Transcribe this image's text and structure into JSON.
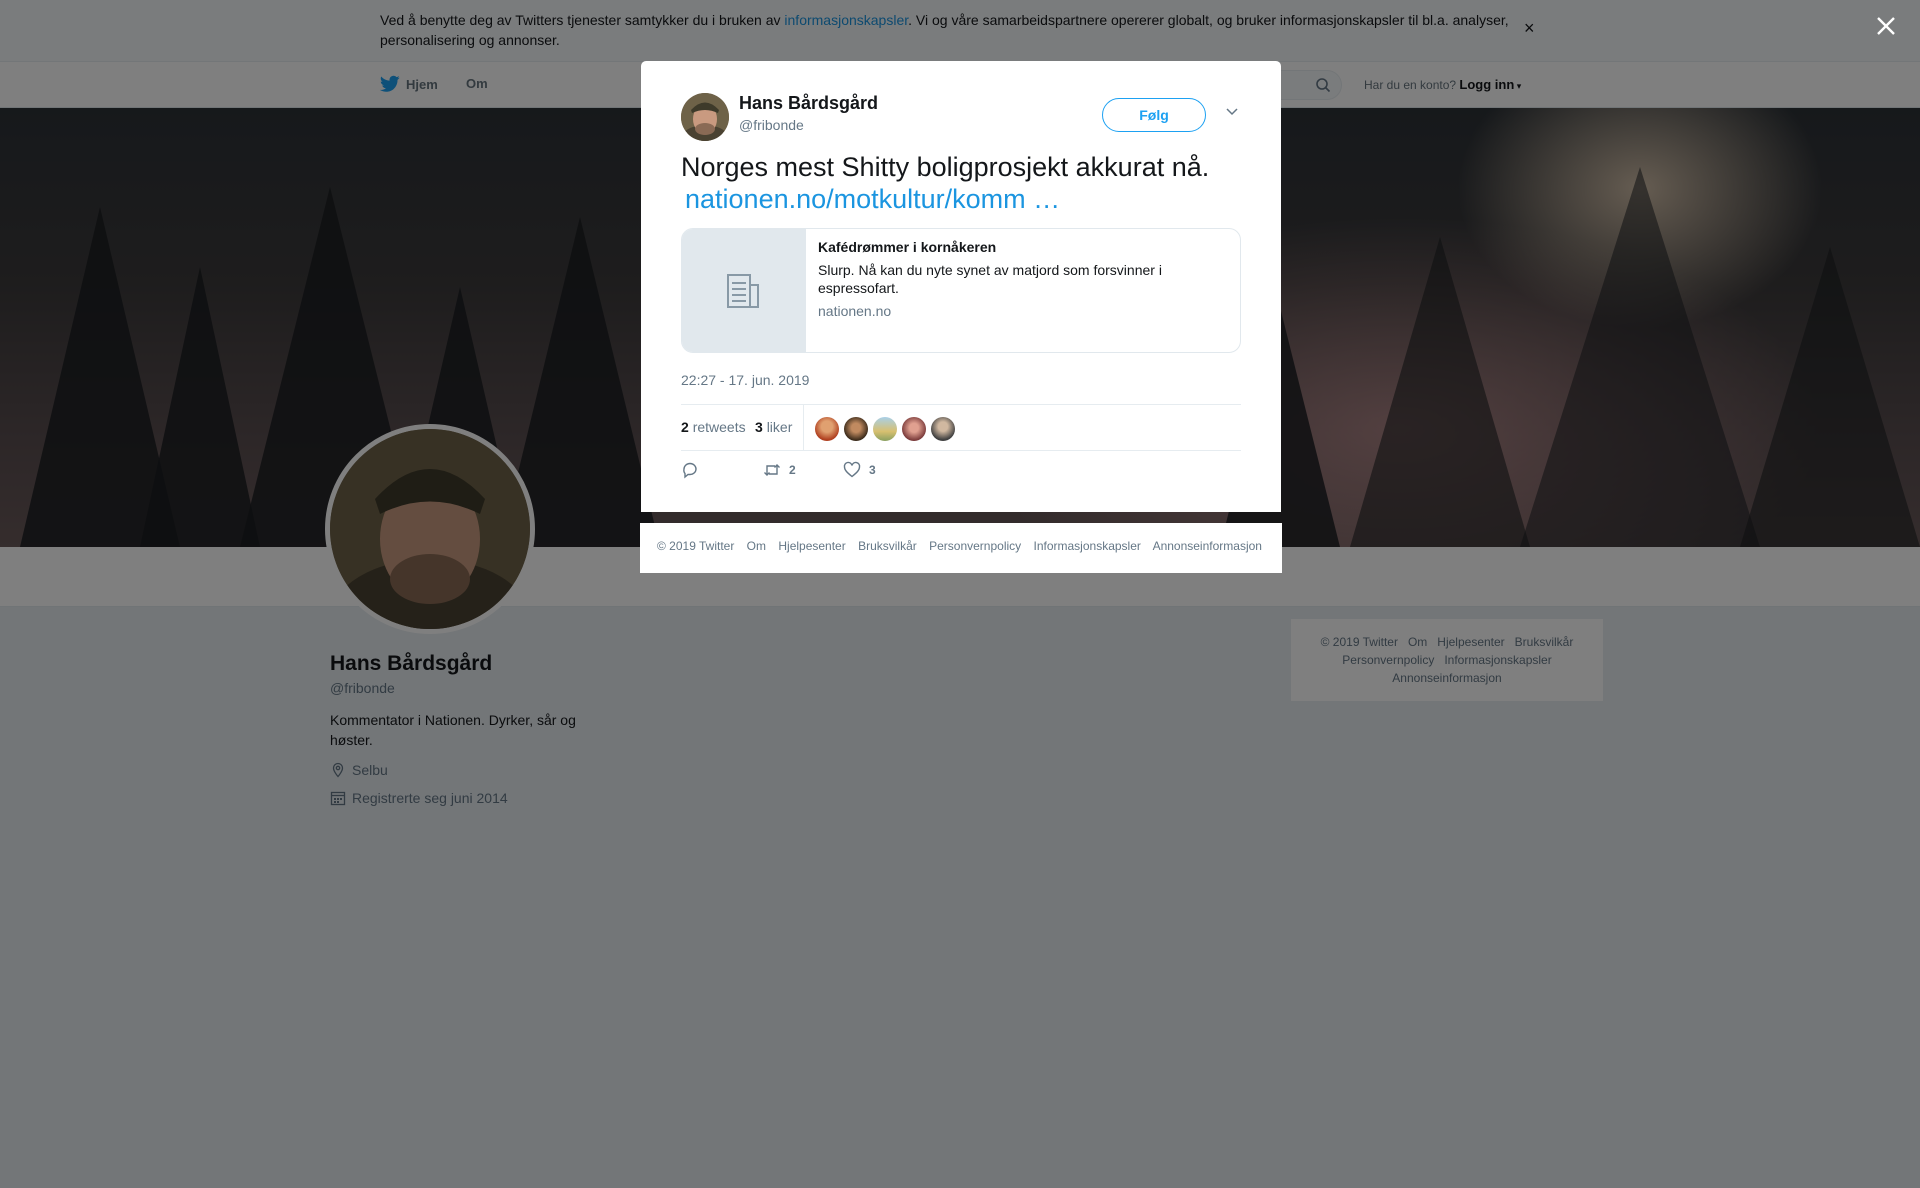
{
  "cookie_banner": {
    "text_before": "Ved å benytte deg av Twitters tjenester samtykker du i bruken av ",
    "link": "informasjonskapsler",
    "text_after": ". Vi og våre samarbeidspartnere opererer globalt, og bruker informasjonskapsler til bl.a. analyser, personalisering og annonser.",
    "close": "×"
  },
  "nav": {
    "home": "Hjem",
    "about": "Om",
    "account_prompt": "Har du en konto?",
    "login": "Logg inn"
  },
  "profile": {
    "name": "Hans Bårdsgård",
    "handle": "@fribonde",
    "bio": "Kommentator i Nationen. Dyrker, sår og høster.",
    "location": "Selbu",
    "joined": "Registrerte seg juni 2014"
  },
  "right_footer": {
    "copyright": "© 2019 Twitter",
    "about": "Om",
    "help": "Hjelpesenter",
    "terms": "Bruksvilkår",
    "privacy": "Personvernpolicy",
    "cookies": "Informasjonskapsler",
    "ads": "Annonseinformasjon"
  },
  "modal": {
    "name": "Hans Bårdsgård",
    "handle": "@fribonde",
    "follow": "Følg",
    "tweet_text": "Norges mest Shitty boligprosjekt akkurat nå.",
    "tweet_link": "nationen.no/motkultur/komm …",
    "card": {
      "title": "Kafédrømmer i kornåkeren",
      "description": "Slurp. Nå kan du nyte synet av matjord som forsvinner i espressofart.",
      "domain": "nationen.no"
    },
    "timestamp": "22:27 - 17. jun. 2019",
    "retweets_count": "2",
    "retweets_label": "retweets",
    "likes_count": "3",
    "likes_label": "liker",
    "action_retweets": "2",
    "action_likes": "3"
  },
  "modal_footer": {
    "copyright": "© 2019 Twitter",
    "about": "Om",
    "help": "Hjelpesenter",
    "terms": "Bruksvilkår",
    "privacy": "Personvernpolicy",
    "cookies": "Informasjonskapsler",
    "ads": "Annonseinformasjon"
  },
  "icons": {
    "twitter": "twitter-bird-icon",
    "search": "search-icon",
    "close": "close-icon",
    "location": "location-pin-icon",
    "calendar": "calendar-icon",
    "reply": "reply-icon",
    "retweet": "retweet-icon",
    "like": "heart-icon",
    "article": "article-icon"
  },
  "colors": {
    "accent": "#1da1f2",
    "link": "#1b95e0",
    "overlay": "rgba(0,0,0,0.5)"
  }
}
